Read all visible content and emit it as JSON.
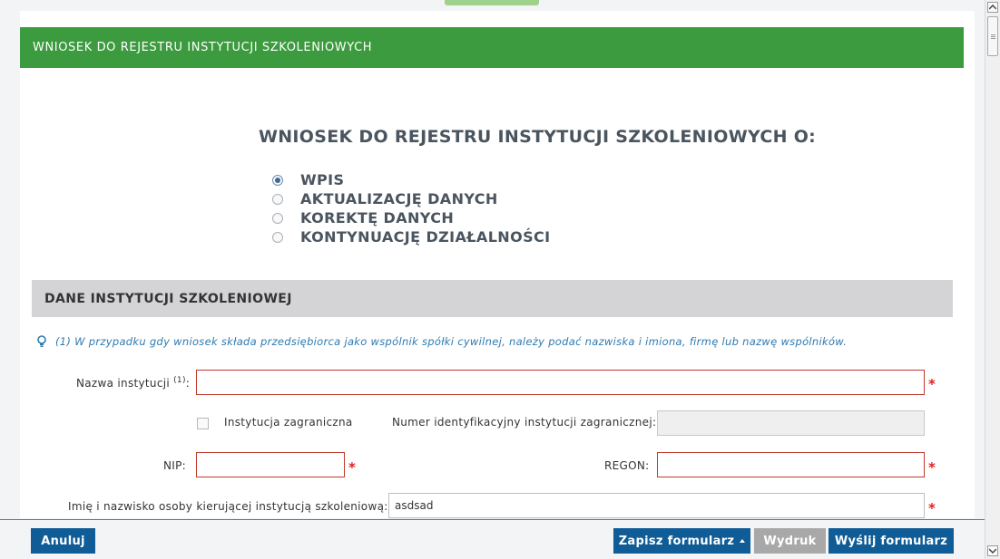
{
  "header": {
    "title": "WNIOSEK DO REJESTRU INSTYTUCJI SZKOLENIOWYCH"
  },
  "form": {
    "title": "WNIOSEK DO REJESTRU INSTYTUCJI SZKOLENIOWYCH O:",
    "options": [
      {
        "label": "WPIS",
        "checked": true
      },
      {
        "label": "AKTUALIZACJĘ DANYCH",
        "checked": false
      },
      {
        "label": "KOREKTĘ DANYCH",
        "checked": false
      },
      {
        "label": "KONTYNUACJĘ DZIAŁALNOŚCI",
        "checked": false
      }
    ]
  },
  "section": {
    "title": "DANE INSTYTUCJI SZKOLENIOWEJ",
    "note": "(1) W przypadku gdy wniosek składa przedsiębiorca jako wspólnik spółki cywilnej, należy podać nazwiska i imiona, firmę lub nazwę wspólników.",
    "note_icon": "lightbulb-icon"
  },
  "fields": {
    "nazwa_label": "Nazwa instytucji",
    "nazwa_sup": "(1)",
    "nazwa_colon": ":",
    "nazwa_value": "",
    "zagraniczna_label": "Instytucja zagraniczna",
    "zagraniczna_checked": false,
    "numer_label": "Numer identyfikacyjny instytucji zagranicznej:",
    "numer_value": "",
    "nip_label": "NIP:",
    "nip_value": "",
    "regon_label": "REGON:",
    "regon_value": "",
    "kierownik_label": "Imię i nazwisko osoby kierującej instytucją szkoleniową:",
    "kierownik_value": "asdsad",
    "required_mark": "*"
  },
  "footer": {
    "cancel_label": "Anuluj",
    "save_label": "Zapisz formularz",
    "print_label": "Wydruk",
    "send_label": "Wyślij formularz"
  },
  "colors": {
    "header_green": "#3c9b3e",
    "button_blue": "#0f5c96",
    "required_red": "#e02020",
    "note_blue": "#2e7ab0"
  }
}
